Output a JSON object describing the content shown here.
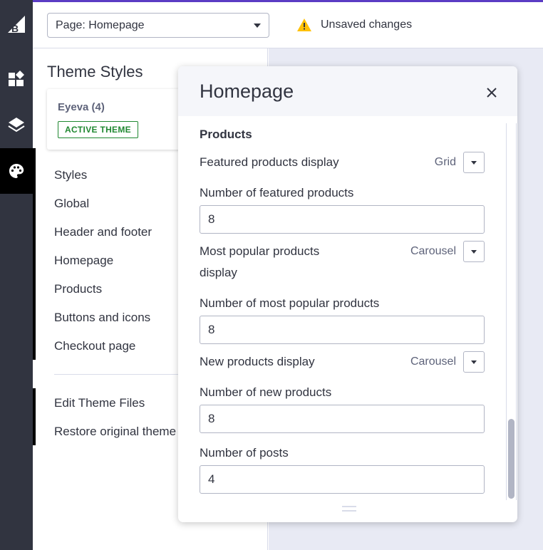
{
  "rail": {
    "items": [
      {
        "name": "bigcommerce-logo-icon",
        "label": "B"
      },
      {
        "name": "page-builder-icon"
      },
      {
        "name": "layers-icon"
      },
      {
        "name": "palette-icon"
      }
    ]
  },
  "header": {
    "page_select_value": "Page: Homepage",
    "unsaved_text": "Unsaved changes"
  },
  "sidebar": {
    "title": "Theme Styles",
    "theme_name": "Eyeva (4)",
    "active_badge": "ACTIVE THEME",
    "nav_items": [
      "Styles",
      "Global",
      "Header and footer",
      "Homepage",
      "Products",
      "Buttons and icons",
      "Checkout page"
    ],
    "footer_items": [
      "Edit Theme Files",
      "Restore original theme styles"
    ]
  },
  "modal": {
    "title": "Homepage",
    "section_title": "Products",
    "featured_display_label": "Featured products display",
    "featured_display_value": "Grid",
    "featured_count_label": "Number of featured products",
    "featured_count_value": "8",
    "popular_display_label_line1": "Most popular products",
    "popular_display_label_line2": "display",
    "popular_display_value": "Carousel",
    "popular_count_label": "Number of most popular products",
    "popular_count_value": "8",
    "new_display_label": "New products display",
    "new_display_value": "Carousel",
    "new_count_label": "Number of new products",
    "new_count_value": "8",
    "posts_label": "Number of posts",
    "posts_value": "4"
  }
}
